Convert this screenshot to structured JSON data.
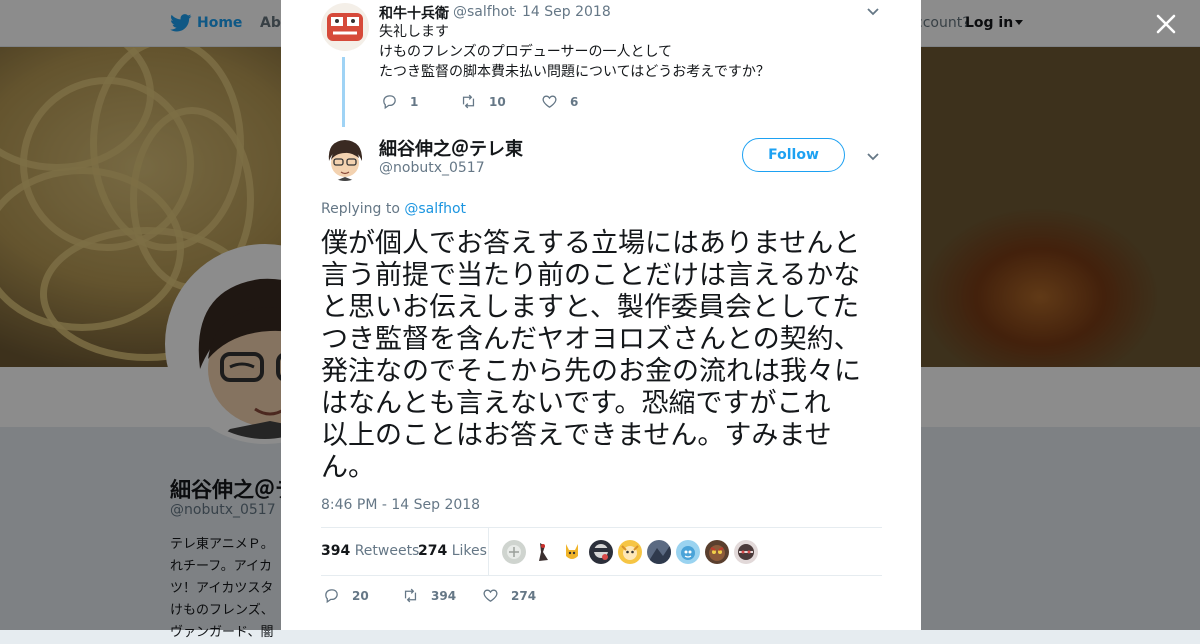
{
  "background": {
    "nav_home": "Home",
    "nav_about": "Abo",
    "account_text": "ccount?",
    "login": "Log in",
    "profile_name": "細谷伸之＠テ",
    "profile_handle": "@nobutx_0517",
    "bio_lines": [
      "テレ東アニメＰ。",
      "れチーフ。アイカ",
      "ツ！アイカツスタ",
      "けものフレンズ、",
      "ヴァンガード、闇"
    ]
  },
  "parent_tweet": {
    "name": "和牛十兵衛",
    "handle": "@salfhot",
    "separator": "·",
    "date": "14 Sep 2018",
    "lines": [
      "失礼します",
      "けものフレンズのプロデューサーの一人として",
      "たつき監督の脚本費未払い問題についてはどうお考えですか？"
    ],
    "replies": "1",
    "retweets": "10",
    "likes": "6"
  },
  "main_tweet": {
    "name": "細谷伸之＠テレ東",
    "handle": "@nobutx_0517",
    "follow_label": "Follow",
    "replying_prefix": "Replying to",
    "replying_to": "@salfhot",
    "lines": [
      "僕が個人でお答えする立場にはありませんと",
      "言う前提で当たり前のことだけは言えるかな",
      "と思いお伝えしますと、製作委員会としてた",
      "つき監督を含んだヤオヨロズさんとの契約、",
      "発注なのでそこから先のお金の流れは我々に",
      "はなんとも言えないです。恐縮ですがこれ",
      "以上のことはお答えできません。すみませ",
      "ん。"
    ],
    "timestamp": "8:46 PM - 14 Sep 2018",
    "retweet_count": "394",
    "retweet_label": "Retweets",
    "like_count": "274",
    "like_label": "Likes",
    "reply_count": "20",
    "action_retweets": "394",
    "action_likes": "274"
  },
  "colors": {
    "twitter_blue": "#1da1f2",
    "link_blue": "#1b95e0",
    "text": "#14171a",
    "muted": "#657786"
  },
  "icons": [
    "twitter-bird-icon",
    "caret-down-icon",
    "close-icon",
    "chevron-down-icon",
    "reply-icon",
    "retweet-icon",
    "heart-icon"
  ]
}
